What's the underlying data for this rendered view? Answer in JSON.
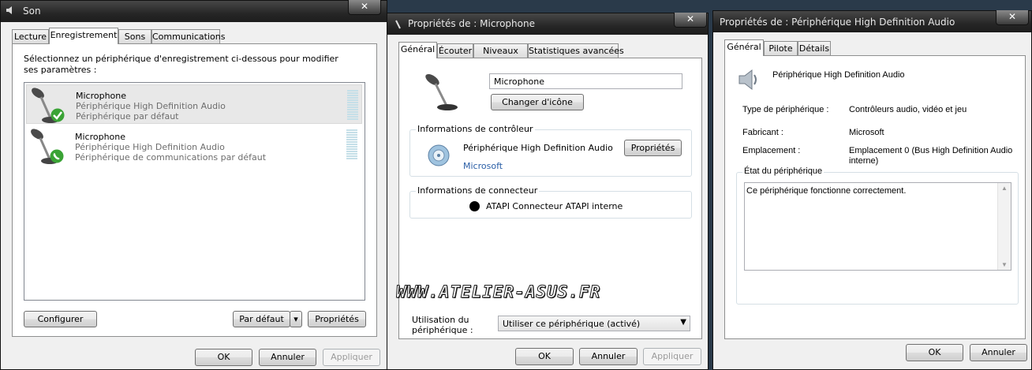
{
  "son": {
    "title": "Son",
    "tabs": [
      "Lecture",
      "Enregistrement",
      "Sons",
      "Communications"
    ],
    "instruction": "Sélectionnez un périphérique d'enregistrement ci-dessous pour modifier ses paramètres :",
    "devices": [
      {
        "name": "Microphone",
        "driver": "Périphérique High Definition Audio",
        "status": "Périphérique par défaut",
        "badge": "check-icon"
      },
      {
        "name": "Microphone",
        "driver": "Périphérique High Definition Audio",
        "status": "Périphérique de communications par défaut",
        "badge": "phone-icon"
      }
    ],
    "configure_label": "Configurer",
    "default_label": "Par défaut",
    "properties_label": "Propriétés",
    "ok_label": "OK",
    "cancel_label": "Annuler",
    "apply_label": "Appliquer"
  },
  "micprops": {
    "title": "Propriétés de : Microphone",
    "tabs": [
      "Général",
      "Écouter",
      "Niveaux",
      "Statistiques avancées"
    ],
    "name_value": "Microphone",
    "change_icon_label": "Changer d'icône",
    "controller_group_label": "Informations de contrôleur",
    "controller_name": "Périphérique High Definition Audio",
    "controller_vendor": "Microsoft",
    "controller_properties_label": "Propriétés",
    "connector_group_label": "Informations de connecteur",
    "connector_text": "ATAPI Connecteur ATAPI interne",
    "usage_label_line1": "Utilisation du",
    "usage_label_line2": "périphérique :",
    "usage_value": "Utiliser ce périphérique (activé)",
    "ok_label": "OK",
    "cancel_label": "Annuler",
    "apply_label": "Appliquer"
  },
  "hdaprops": {
    "title": "Propriétés de : Périphérique High Definition Audio",
    "tabs": [
      "Général",
      "Pilote",
      "Détails"
    ],
    "device_name": "Périphérique High Definition Audio",
    "type_label": "Type de périphérique :",
    "type_value": "Contrôleurs audio, vidéo et jeu",
    "manufacturer_label": "Fabricant :",
    "manufacturer_value": "Microsoft",
    "location_label": "Emplacement :",
    "location_value_line1": "Emplacement 0 (Bus High Definition Audio",
    "location_value_line2": "interne)",
    "status_group_label": "État du périphérique",
    "status_text": "Ce périphérique fonctionne correctement.",
    "ok_label": "OK",
    "cancel_label": "Annuler"
  },
  "watermark": "WWW.ATELIER-ASUS.FR"
}
